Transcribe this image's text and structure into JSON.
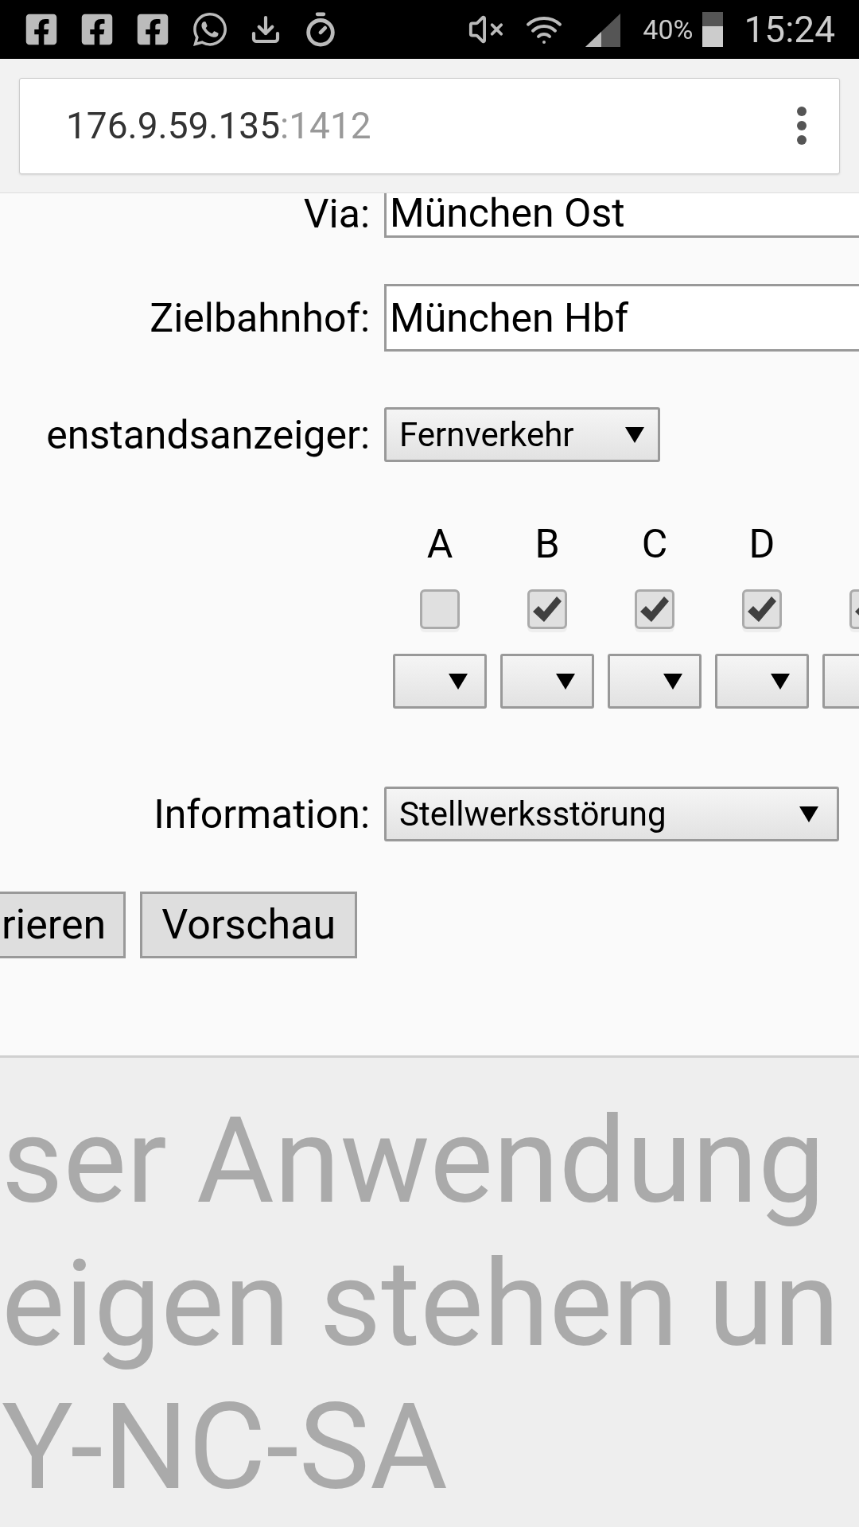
{
  "status_bar": {
    "battery": "40%",
    "time": "15:24"
  },
  "address_bar": {
    "host": "176.9.59.135",
    "port": ":1412"
  },
  "form": {
    "via": {
      "label": "Via:",
      "value": "München Ost"
    },
    "destination": {
      "label": "Zielbahnhof:",
      "value": "München Hbf"
    },
    "display": {
      "label": "enstandsanzeiger:",
      "value": "Fernverkehr"
    },
    "sections": [
      {
        "label": "A",
        "checked": false
      },
      {
        "label": "B",
        "checked": true
      },
      {
        "label": "C",
        "checked": true
      },
      {
        "label": "D",
        "checked": true
      },
      {
        "checked": true
      }
    ],
    "information": {
      "label": "Information:",
      "value": "Stellwerksstörung"
    },
    "buttons": [
      "rieren",
      "Vorschau"
    ]
  },
  "footer": {
    "lines": [
      "ser Anwendung",
      "eigen stehen un",
      "Y-NC-SA"
    ]
  }
}
